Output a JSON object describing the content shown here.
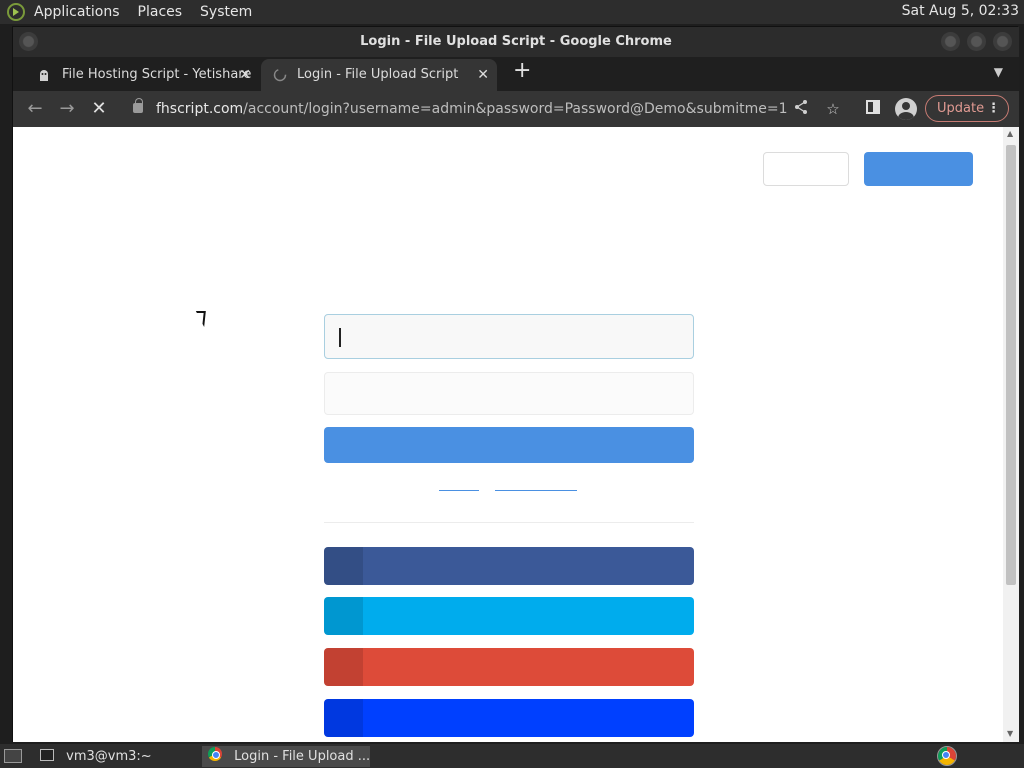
{
  "top_panel": {
    "menus": [
      "Applications",
      "Places",
      "System"
    ],
    "clock": "Sat Aug  5, 02:33"
  },
  "window": {
    "title": "Login - File Upload Script - Google Chrome"
  },
  "tabs": [
    {
      "label": "File Hosting Script - Yetishare",
      "close": "✕",
      "icon": "yetishare-favicon-icon"
    },
    {
      "label": "Login - File Upload Script",
      "close": "✕",
      "icon": "loading-spinner-icon"
    }
  ],
  "toolbar": {
    "new_tab": "+",
    "url_host": "fhscript.com",
    "url_path": "/account/login?username=admin&password=Password@Demo&submitme=1",
    "update_label": "Update",
    "menu_dots": "⋮"
  },
  "taskbar": {
    "items": [
      {
        "label": "vm3@vm3:~",
        "icon": "terminal-icon"
      },
      {
        "label": "Login - File Upload ...",
        "icon": "chrome-icon"
      }
    ]
  },
  "colors": {
    "primary": "#4a90e2",
    "facebook": "#3b5998",
    "twitter": "#00aced",
    "google": "#dd4b39",
    "fourth_social": "#0040ff"
  }
}
